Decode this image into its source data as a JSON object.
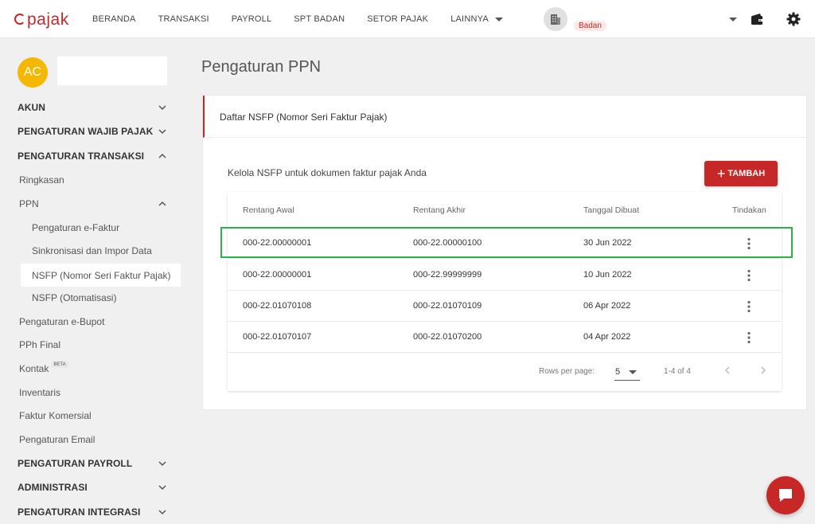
{
  "header": {
    "logo_text": "pajak",
    "nav": [
      {
        "label": "BERANDA"
      },
      {
        "label": "TRANSAKSI"
      },
      {
        "label": "PAYROLL"
      },
      {
        "label": "SPT BADAN"
      },
      {
        "label": "SETOR PAJAK"
      },
      {
        "label": "LAINNYA"
      }
    ],
    "company_badge": "Badan"
  },
  "sidebar": {
    "avatar_initials": "AC",
    "items": [
      {
        "label": "AKUN",
        "type": "section",
        "expanded": false
      },
      {
        "label": "PENGATURAN WAJIB PAJAK",
        "type": "section",
        "expanded": false
      },
      {
        "label": "PENGATURAN TRANSAKSI",
        "type": "section",
        "expanded": true
      },
      {
        "label": "Ringkasan",
        "type": "item"
      },
      {
        "label": "PPN",
        "type": "item",
        "expanded": true
      },
      {
        "label": "Pengaturan e-Faktur",
        "type": "subitem"
      },
      {
        "label": "Sinkronisasi dan Impor Data",
        "type": "subitem"
      },
      {
        "label": "NSFP (Nomor Seri Faktur Pajak)",
        "type": "subitem",
        "active": true
      },
      {
        "label": "NSFP (Otomatisasi)",
        "type": "subitem"
      },
      {
        "label": "Pengaturan e-Bupot",
        "type": "item"
      },
      {
        "label": "PPh Final",
        "type": "item"
      },
      {
        "label": "Kontak",
        "type": "item",
        "badge": "BETA"
      },
      {
        "label": "Inventaris",
        "type": "item"
      },
      {
        "label": "Faktur Komersial",
        "type": "item"
      },
      {
        "label": "Pengaturan Email",
        "type": "item"
      },
      {
        "label": "PENGATURAN PAYROLL",
        "type": "section",
        "expanded": false
      },
      {
        "label": "ADMINISTRASI",
        "type": "section",
        "expanded": false
      },
      {
        "label": "PENGATURAN INTEGRASI",
        "type": "section",
        "expanded": false
      }
    ]
  },
  "main": {
    "page_title": "Pengaturan PPN",
    "card_title": "Daftar NSFP (Nomor Seri Faktur Pajak)",
    "description": "Kelola NSFP untuk dokumen faktur pajak Anda",
    "add_button": "TAMBAH",
    "table": {
      "columns": [
        "Rentang Awal",
        "Rentang Akhir",
        "Tanggal Dibuat",
        "Tindakan"
      ],
      "rows": [
        [
          "000-22.00000001",
          "000-22.00000100",
          "30 Jun 2022"
        ],
        [
          "000-22.00000001",
          "000-22.99999999",
          "10 Jun 2022"
        ],
        [
          "000-22.01070108",
          "000-22.01070109",
          "06 Apr 2022"
        ],
        [
          "000-22.01070107",
          "000-22.01070200",
          "04 Apr 2022"
        ]
      ],
      "highlighted_row": 0,
      "rows_per_page_label": "Rows per page:",
      "rows_per_page": "5",
      "range_label": "1-4 of 4"
    }
  },
  "colors": {
    "brand": "#c62828",
    "highlight": "#2bb24c",
    "avatar": "#f5b800"
  }
}
